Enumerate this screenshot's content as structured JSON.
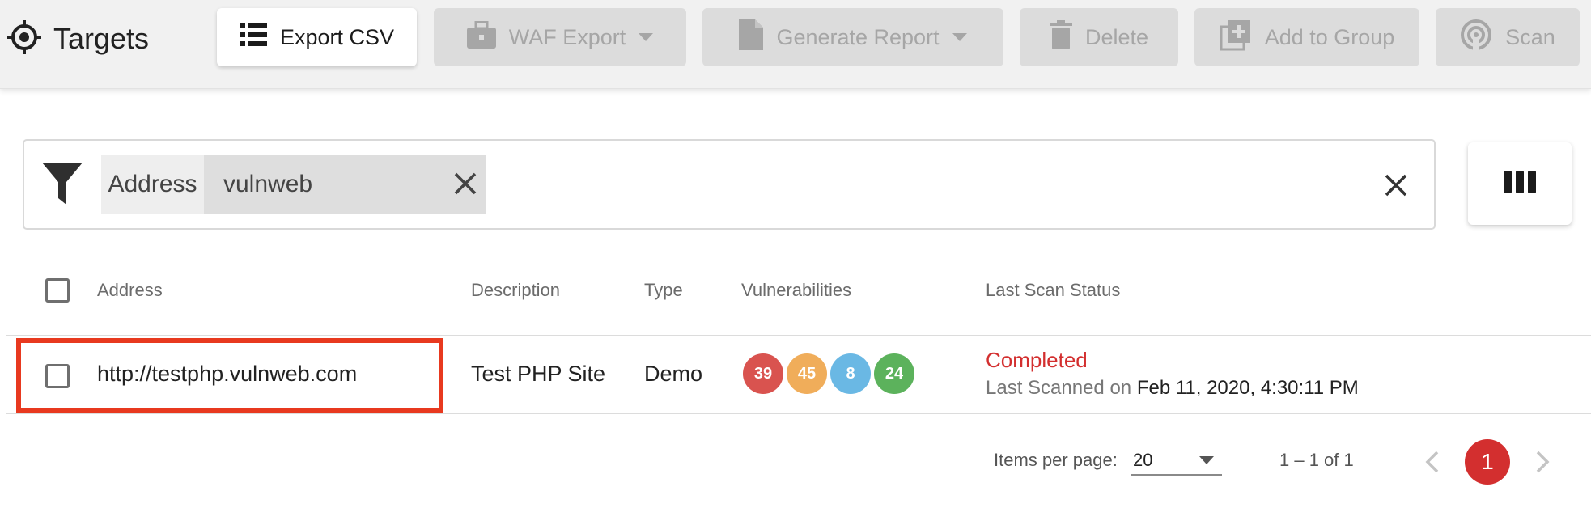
{
  "header": {
    "title": "Targets",
    "title_icon": "crosshair-icon",
    "buttons": {
      "export_csv": "Export CSV",
      "waf_export": "WAF Export",
      "generate_report": "Generate Report",
      "delete": "Delete",
      "add_to_group": "Add to Group",
      "scan": "Scan"
    }
  },
  "filter": {
    "icon": "filter-icon",
    "key": "Address",
    "value": "vulnweb"
  },
  "table": {
    "columns": [
      "Address",
      "Description",
      "Type",
      "Vulnerabilities",
      "Last Scan Status"
    ],
    "rows": [
      {
        "address": "http://testphp.vulnweb.com",
        "description": "Test PHP Site",
        "type": "Demo",
        "vulnerabilities": {
          "high": "39",
          "medium": "45",
          "low": "8",
          "info": "24"
        },
        "status": "Completed",
        "last_scanned_prefix": "Last Scanned on",
        "last_scanned_date": "Feb 11, 2020, 4:30:11 PM"
      }
    ]
  },
  "pagination": {
    "items_per_page_label": "Items per page:",
    "items_per_page_value": "20",
    "range": "1 – 1 of 1",
    "current_page": "1"
  },
  "colors": {
    "high": "#d9534f",
    "medium": "#f0ad5a",
    "low": "#6ab8e4",
    "info": "#5cb25c",
    "status_completed": "#d32f2f",
    "highlight_border": "#e8391f"
  }
}
